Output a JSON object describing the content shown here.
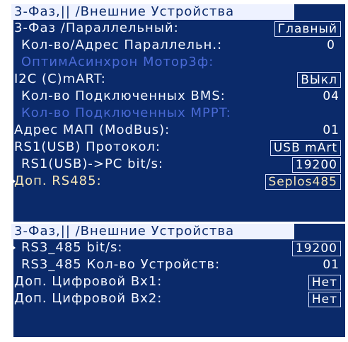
{
  "screen1": {
    "title": "3-Фаз,|| /Внешние Устройства",
    "rows": [
      {
        "label": "3-Фаз /Параллельный:",
        "value": "Главный"
      },
      {
        "label": "Кол-во/Адрес Параллельн.:",
        "value": "0"
      },
      {
        "label": "ОптимАсинхрон Мотор3ф:",
        "value": ""
      },
      {
        "label": "I2C (C)mART:",
        "value": "ВЫкл"
      },
      {
        "label": "Кол-во Подключенных BMS:",
        "value": "04"
      },
      {
        "label": "Кол-во Подключенных MPPT:",
        "value": ""
      },
      {
        "label": "Адрес МАП (ModBus):",
        "value": "01"
      },
      {
        "label": "RS1(USB) Протокол:",
        "value": "USB mArt"
      },
      {
        "label": "RS1(USB)->PC bit/s:",
        "value": "19200"
      },
      {
        "label": "Доп. RS485:",
        "value": "Seplos485"
      }
    ]
  },
  "screen2": {
    "title": "3-Фаз,|| /Внешние Устройства",
    "rows": [
      {
        "label": "RS3_485 bit/s:",
        "value": "19200"
      },
      {
        "label": "RS3_485 Кол-во Устройств:",
        "value": "01"
      },
      {
        "label": "Доп. Цифровой Вх1:",
        "value": "Нет"
      },
      {
        "label": "Доп. Цифровой Вх2:",
        "value": "Нет"
      }
    ]
  },
  "colors": {
    "background": "#0b2a6a",
    "title_bg": "#eef2ff",
    "text": "#f3f6ff",
    "disabled_text": "#4a6ad6",
    "accent_text": "#f6e6b8"
  }
}
